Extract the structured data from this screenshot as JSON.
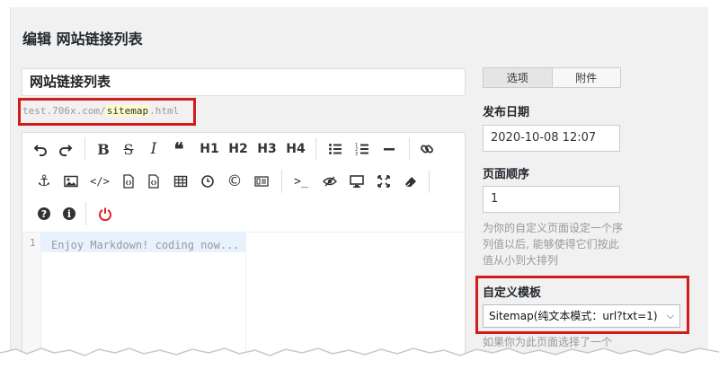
{
  "page": {
    "title": "编辑 网站链接列表"
  },
  "post": {
    "title": "网站链接列表",
    "permalink_prefix": "test.706x.com/",
    "permalink_slug": "sitemap",
    "permalink_suffix": ".html"
  },
  "editor": {
    "toolbar_text": {
      "h1": "H1",
      "h2": "H2",
      "h3": "H3",
      "h4": "H4"
    },
    "icons": [
      "undo-icon",
      "redo-icon",
      "bold-icon",
      "strikethrough-icon",
      "italic-icon",
      "quote-icon",
      "unordered-list-icon",
      "ordered-list-icon",
      "horizontal-rule-icon",
      "link-icon",
      "anchor-icon",
      "image-icon",
      "code-icon",
      "code-block-icon",
      "code-file-icon",
      "table-icon",
      "clock-icon",
      "copyright-icon",
      "html-entities-icon",
      "terminal-icon",
      "hide-icon",
      "preview-icon",
      "fullscreen-icon",
      "clear-icon",
      "help-icon",
      "info-icon",
      "power-icon"
    ],
    "line_number": "1",
    "content": "Enjoy Markdown! coding now..."
  },
  "sidebar": {
    "tabs": [
      {
        "label": "选项"
      },
      {
        "label": "附件"
      }
    ],
    "publish_date_label": "发布日期",
    "publish_date_value": "2020-10-08 12:07",
    "order_label": "页面顺序",
    "order_value": "1",
    "order_help": "为你的自定义页面设定一个序列值以后, 能够使得它们按此值从小到大排列",
    "template_label": "自定义模板",
    "template_value": "Sitemap(纯文本模式：url?txt=1)",
    "template_help": "如果你为此页面选择了一个"
  },
  "colors": {
    "highlight_border": "#d11c1c",
    "slug_background": "#fffbcc",
    "power_icon": "#e32020"
  }
}
